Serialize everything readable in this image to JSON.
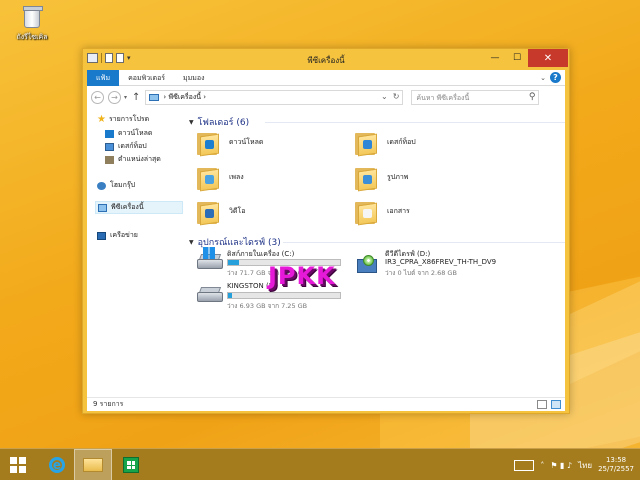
{
  "desktop": {
    "recycle_bin_label": "ถังรีไซเคิล",
    "watermark": "JPKK"
  },
  "window": {
    "title": "พีซีเครื่องนี้",
    "min_glyph": "—",
    "max_glyph": "☐",
    "close_glyph": "✕",
    "qat_dropdown": "▾"
  },
  "ribbon": {
    "tabs": [
      {
        "label": "แฟ้ม",
        "active": true
      },
      {
        "label": "คอมพิวเตอร์"
      },
      {
        "label": "มุมมอง"
      }
    ],
    "expand_glyph": "⌄",
    "help_glyph": "?"
  },
  "address": {
    "back_glyph": "←",
    "forward_glyph": "→",
    "dropdown_glyph": "▾",
    "up_glyph": "↑",
    "path": "พีซีเครื่องนี้",
    "path_sep": "›",
    "refresh_glyph": "↻",
    "path_dropdown_glyph": "⌄",
    "search_placeholder": "ค้นหา พีซีเครื่องนี้",
    "search_glyph": "⚲"
  },
  "nav": {
    "favorites_label": "รายการโปรด",
    "favorites": [
      {
        "label": "ดาวน์โหลด",
        "icon": "download-icon"
      },
      {
        "label": "เดสก์ท็อป",
        "icon": "desktop-icon"
      },
      {
        "label": "ตำแหน่งล่าสุด",
        "icon": "recent-places-icon"
      }
    ],
    "homegroup_label": "โฮมกรุ๊ป",
    "thispc_label": "พีซีเครื่องนี้",
    "network_label": "เครือข่าย"
  },
  "folders_group": {
    "title": "โฟลเดอร์ (6)",
    "chevron": "▼",
    "items": [
      {
        "label": "ดาวน์โหลด",
        "badge": "#1e7fd0",
        "icon": "downloads-folder-icon"
      },
      {
        "label": "เดสก์ท็อป",
        "badge": "#2f86d6",
        "icon": "desktop-folder-icon"
      },
      {
        "label": "เพลง",
        "badge": "#4aa3e0",
        "icon": "music-folder-icon"
      },
      {
        "label": "รูปภาพ",
        "badge": "#3b8ed8",
        "icon": "pictures-folder-icon"
      },
      {
        "label": "วิดีโอ",
        "badge": "#2c6db7",
        "icon": "videos-folder-icon"
      },
      {
        "label": "เอกสาร",
        "badge": "#f5f5f5",
        "icon": "documents-folder-icon"
      }
    ]
  },
  "drives_group": {
    "title": "อุปกรณ์และไดรฟ์ (3)",
    "chevron": "▼",
    "drives": [
      {
        "name": "ดิสก์ภายในเครื่อง (C:)",
        "used_fraction": 0.1,
        "free_text": "ว่าง 71.7 GB จาก 79.6 GB"
      },
      {
        "name": "ดีวีดีไดรฟ์ (D:)",
        "label2": "IR3_CPRA_X86FREV_TH-TH_DV9",
        "free_text": "ว่าง 0 ไบต์ จาก 2.68 GB"
      },
      {
        "name": "KINGSTON (E:)",
        "used_fraction": 0.04,
        "free_text": "ว่าง 6.93 GB จาก 7.25 GB"
      }
    ]
  },
  "status": {
    "item_count": "9 รายการ"
  },
  "taskbar": {
    "ie_glyph": "e",
    "tray_up_glyph": "˄",
    "tray_icons": "⚑ ▮ ♪",
    "lang": "ไทย",
    "time": "13:58",
    "date": "25/7/2557"
  }
}
